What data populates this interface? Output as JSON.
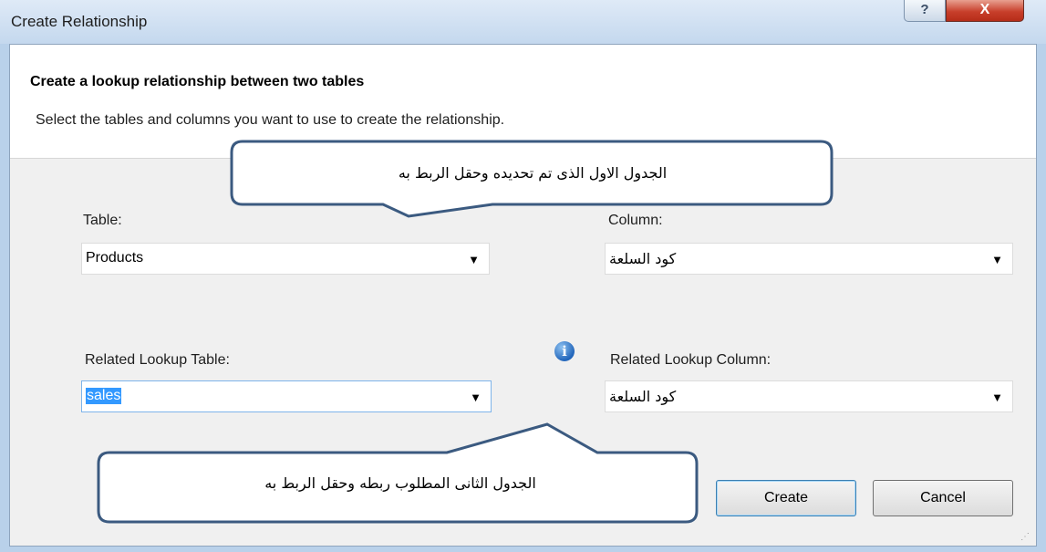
{
  "window": {
    "title": "Create Relationship",
    "help_label": "?",
    "close_label": "X"
  },
  "header": {
    "title": "Create a lookup relationship between two tables",
    "subtitle": "Select the tables and columns you want to use to create the relationship."
  },
  "form": {
    "table_label": "Table:",
    "table_value": "Products",
    "column_label": "Column:",
    "column_value": "كود السلعة",
    "related_table_label": "Related Lookup Table:",
    "related_table_value": "sales",
    "related_column_label": "Related Lookup Column:",
    "related_column_value": "كود السلعة",
    "dropdown_arrow": "▼",
    "info_glyph": "i"
  },
  "buttons": {
    "create": "Create",
    "cancel": "Cancel"
  },
  "callouts": {
    "top": "الجدول الاول الذى تم تحديده وحقل الربط به",
    "bottom": "الجدول الثانى المطلوب ربطه وحقل الربط به"
  },
  "colors": {
    "selection": "#3399ff",
    "callout_border": "#3b5a80",
    "close_button": "#c8402c"
  }
}
